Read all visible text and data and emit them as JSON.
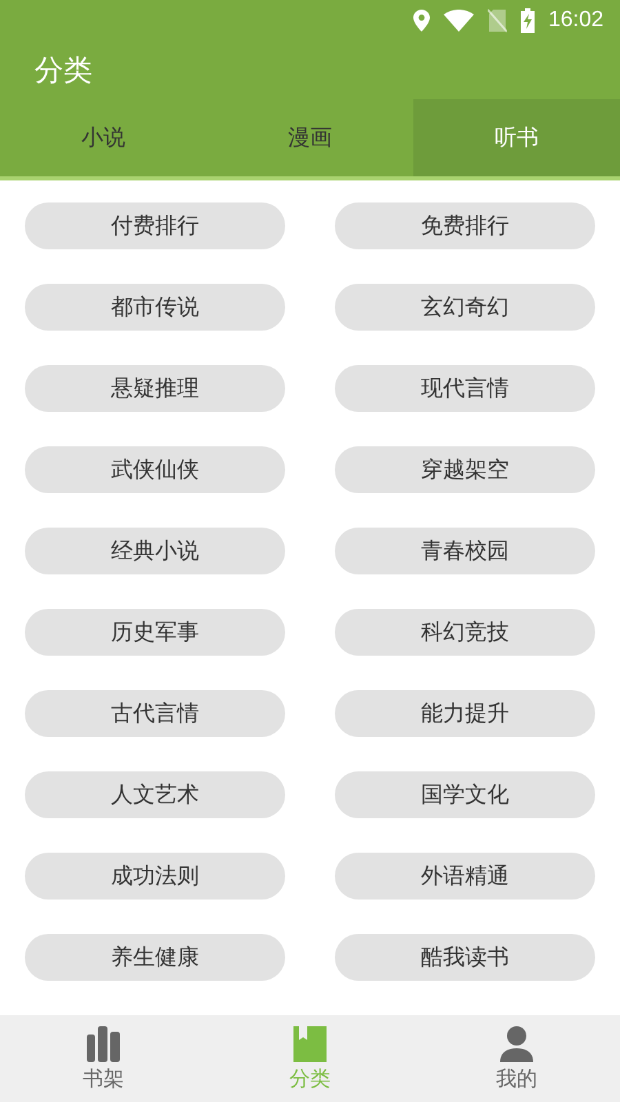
{
  "status_bar": {
    "time": "16:02"
  },
  "header": {
    "title": "分类"
  },
  "tabs": [
    {
      "label": "小说",
      "selected": false
    },
    {
      "label": "漫画",
      "selected": false
    },
    {
      "label": "听书",
      "selected": true
    }
  ],
  "categories": [
    "付费排行",
    "免费排行",
    "都市传说",
    "玄幻奇幻",
    "悬疑推理",
    "现代言情",
    "武侠仙侠",
    "穿越架空",
    "经典小说",
    "青春校园",
    "历史军事",
    "科幻竞技",
    "古代言情",
    "能力提升",
    "人文艺术",
    "国学文化",
    "成功法则",
    "外语精通",
    "养生健康",
    "酷我读书"
  ],
  "bottom_nav": [
    {
      "kind": "shelf",
      "label": "书架",
      "selected": false
    },
    {
      "kind": "category",
      "label": "分类",
      "selected": true
    },
    {
      "kind": "profile",
      "label": "我的",
      "selected": false
    }
  ]
}
